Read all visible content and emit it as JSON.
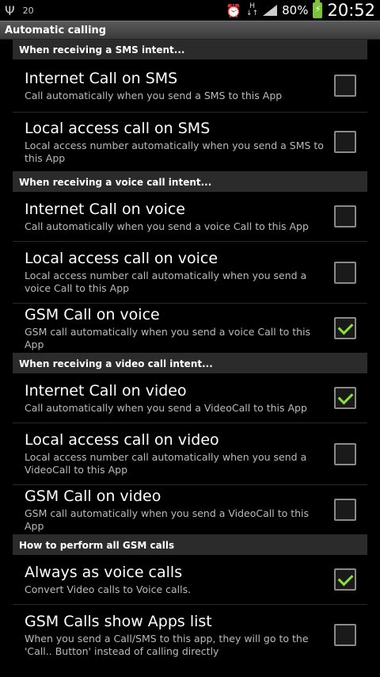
{
  "status_bar": {
    "notif_text": "20",
    "battery_pct": "80%",
    "clock": "20:52",
    "h_label_top": "H",
    "h_label_bottom": "↓↑"
  },
  "title": "Automatic calling",
  "sections": [
    {
      "header": "When receiving a SMS intent...",
      "items": [
        {
          "title": "Internet Call on SMS",
          "summary": "Call automatically when you send a SMS to this App",
          "checked": false
        },
        {
          "title": "Local access call on SMS",
          "summary": "Local access number automatically when you send a SMS to this App",
          "checked": false
        }
      ]
    },
    {
      "header": "When receiving a voice call intent...",
      "items": [
        {
          "title": "Internet Call on voice",
          "summary": "Call automatically when you send a voice Call to this App",
          "checked": false
        },
        {
          "title": "Local access call on voice",
          "summary": "Local access number call automatically when you send a voice Call to this App",
          "checked": false
        },
        {
          "title": "GSM Call on voice",
          "summary": "GSM call automatically when you send a voice Call to this App",
          "checked": true
        }
      ]
    },
    {
      "header": "When receiving a video call intent...",
      "items": [
        {
          "title": "Internet Call on video",
          "summary": "Call automatically when you send a VideoCall to this App",
          "checked": true
        },
        {
          "title": "Local access call on video",
          "summary": "Local access number call automatically when you send a VideoCall to this App",
          "checked": false
        },
        {
          "title": "GSM Call on video",
          "summary": "GSM call automatically when you send a VideoCall to this App",
          "checked": false
        }
      ]
    },
    {
      "header": "How to perform all GSM calls",
      "items": [
        {
          "title": "Always as voice calls",
          "summary": "Convert Video calls to Voice calls.",
          "checked": true
        },
        {
          "title": "GSM Calls show Apps list",
          "summary": "When you send a Call/SMS to this app, they will go to the 'Call.. Button' instead of calling directly",
          "checked": false
        }
      ]
    }
  ]
}
